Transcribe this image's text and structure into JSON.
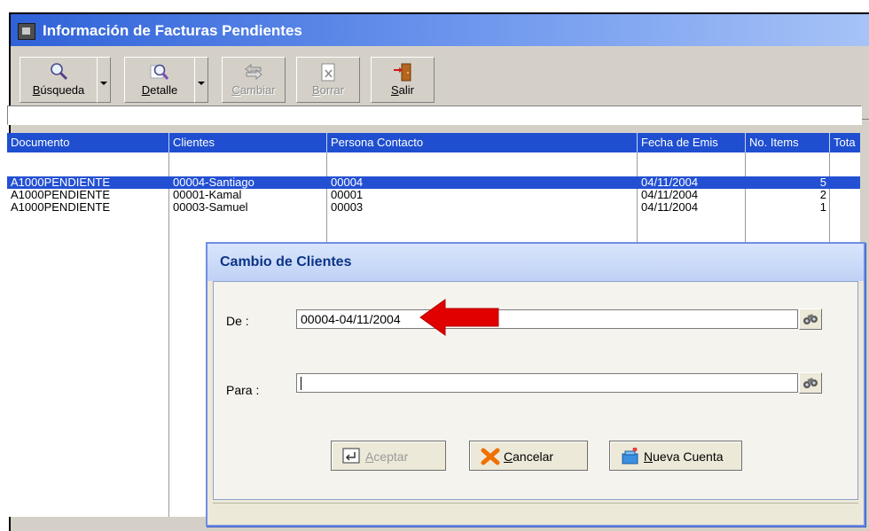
{
  "window": {
    "title": "Información de Facturas Pendientes"
  },
  "toolbar": {
    "buttons": [
      {
        "ul": "B",
        "rest": "úsqueda",
        "icon": "magnifier-icon",
        "enabled": true
      },
      {
        "ul": "D",
        "rest": "etalle",
        "icon": "detail-magnifier-icon",
        "enabled": true
      },
      {
        "ul": "C",
        "rest": "ambiar",
        "icon": "exchange-icon",
        "enabled": false
      },
      {
        "ul": "B",
        "rest": "orrar",
        "icon": "delete-document-icon",
        "enabled": false
      },
      {
        "ul": "S",
        "rest": "alir",
        "icon": "exit-door-icon",
        "enabled": true
      }
    ]
  },
  "grid": {
    "columns": [
      "Documento",
      "Clientes",
      "Persona Contacto",
      "Fecha de Emis",
      "No. Items",
      "Tota"
    ],
    "rows": [
      {
        "documento": "A1000PENDIENTE",
        "cliente": "00004-Santiago",
        "contacto": "00004",
        "fecha": "04/11/2004",
        "items": "5",
        "selected": true
      },
      {
        "documento": "A1000PENDIENTE",
        "cliente": "00001-Kamal",
        "contacto": "00001",
        "fecha": "04/11/2004",
        "items": "2",
        "selected": false
      },
      {
        "documento": "A1000PENDIENTE",
        "cliente": "00003-Samuel",
        "contacto": "00003",
        "fecha": "04/11/2004",
        "items": "1",
        "selected": false
      }
    ]
  },
  "dialog": {
    "title": "Cambio de Clientes",
    "de_label": "De :",
    "de_value": "00004-04/11/2004",
    "para_label": "Para :",
    "para_value": "",
    "buttons": {
      "aceptar_ul": "A",
      "aceptar_rest": "ceptar",
      "cancelar_ul": "C",
      "cancelar_rest": "ancelar",
      "nueva_ul": "N",
      "nueva_rest": "ueva Cuenta"
    }
  },
  "colors": {
    "title_blue": "#2f62d8",
    "header_blue": "#1f4fd0",
    "selection_blue": "#2350d3",
    "annotation_red": "#e00000"
  }
}
